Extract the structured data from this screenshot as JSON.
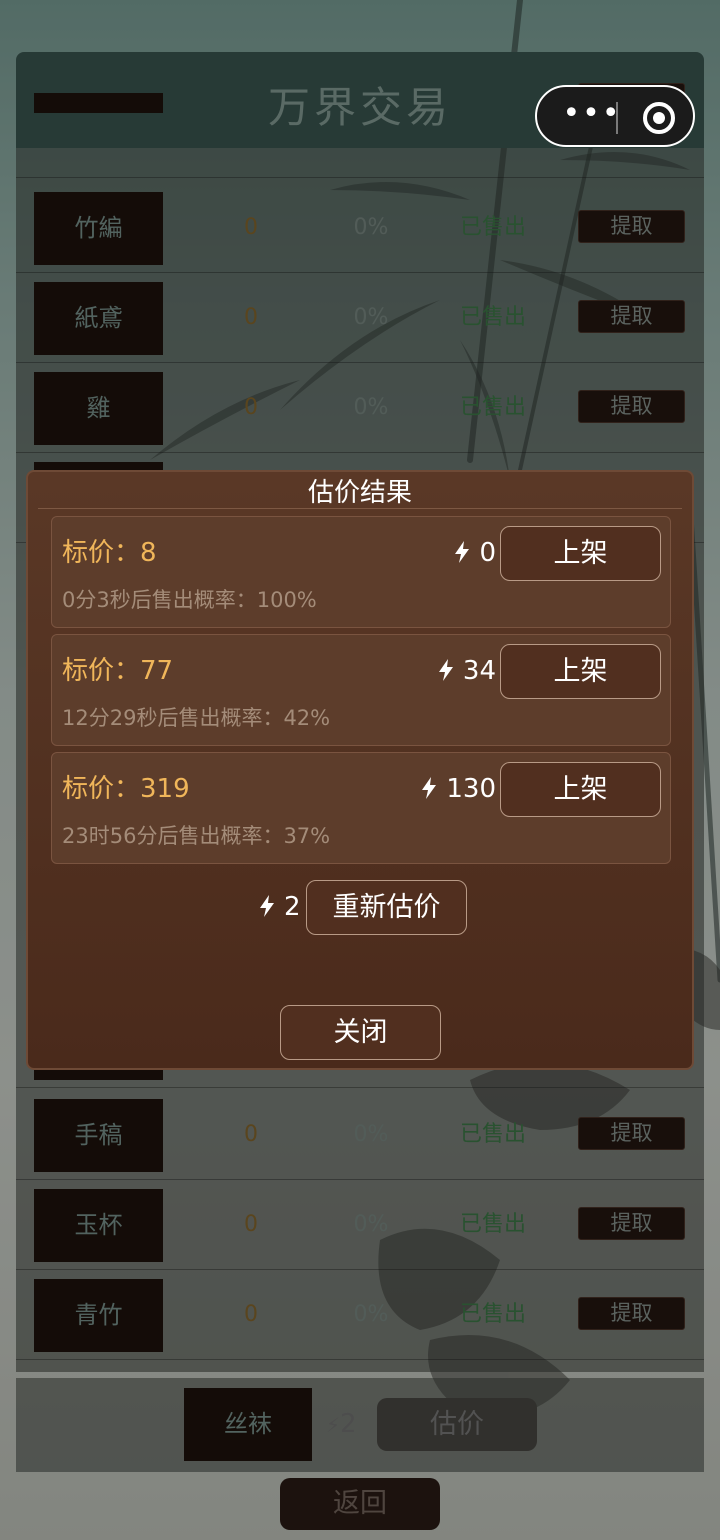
{
  "header": {
    "title": "万界交易"
  },
  "capsule": {
    "more_icon": "more-dots-icon",
    "close_icon": "target-circle-icon"
  },
  "rows": [
    {
      "name": "竹編",
      "price": "0",
      "rate": "0%",
      "status": "已售出",
      "action": "提取"
    },
    {
      "name": "紙鳶",
      "price": "0",
      "rate": "0%",
      "status": "已售出",
      "action": "提取"
    },
    {
      "name": "雞",
      "price": "0",
      "rate": "0%",
      "status": "已售出",
      "action": "提取"
    },
    {
      "name": "手稿",
      "price": "0",
      "rate": "0%",
      "status": "已售出",
      "action": "提取"
    },
    {
      "name": "玉杯",
      "price": "0",
      "rate": "0%",
      "status": "已售出",
      "action": "提取"
    },
    {
      "name": "青竹",
      "price": "0",
      "rate": "0%",
      "status": "已售出",
      "action": "提取"
    }
  ],
  "bottom": {
    "item": "丝袜",
    "cost": "2",
    "estimate_label": "估价",
    "back_label": "返回"
  },
  "modal": {
    "title": "估价结果",
    "offers": [
      {
        "price_label": "标价：8",
        "cost": "0",
        "button": "上架",
        "probability": "0分3秒后售出概率：100%"
      },
      {
        "price_label": "标价：77",
        "cost": "34",
        "button": "上架",
        "probability": "12分29秒后售出概率：42%"
      },
      {
        "price_label": "标价：319",
        "cost": "130",
        "button": "上架",
        "probability": "23时56分后售出概率：37%"
      }
    ],
    "reestimate_cost": "2",
    "reestimate_label": "重新估价",
    "close_label": "关闭"
  },
  "colors": {
    "accent_gold": "#f0b65a",
    "modal_bg": "#4a2a1b",
    "sold_green": "#3f7e4a"
  }
}
